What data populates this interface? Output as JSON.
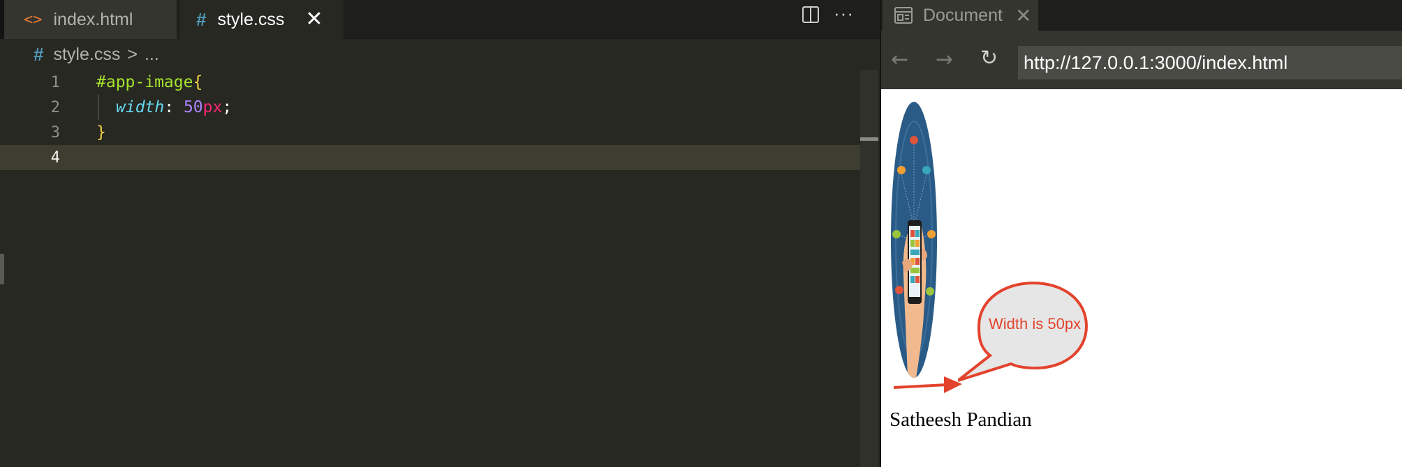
{
  "editor": {
    "tabs": [
      {
        "label": "index.html",
        "icon": "code-icon",
        "active": false
      },
      {
        "label": "style.css",
        "icon": "hash-icon",
        "active": true
      }
    ],
    "tab_close_glyph": "✕",
    "breadcrumb": {
      "file": "style.css",
      "separator": ">",
      "more": "..."
    },
    "code_lines": [
      {
        "number": "1",
        "selector": "#app-image",
        "open_brace": "{"
      },
      {
        "number": "2",
        "property": "width",
        "colon": ": ",
        "number_value": "50",
        "unit": "px",
        "semicolon": ";"
      },
      {
        "number": "3",
        "close_brace": "}"
      },
      {
        "number": "4"
      }
    ],
    "more_actions_glyph": "···"
  },
  "browser": {
    "tab_label": "Document",
    "tab_close_glyph": "✕",
    "nav": {
      "back": "←",
      "forward": "→",
      "reload": "↻"
    },
    "url": "http://127.0.0.1:3000/index.html",
    "page": {
      "callout_text": "Width is 50px",
      "name_text": "Satheesh Pandian"
    }
  },
  "colors": {
    "editor_bg": "#272822",
    "callout_red": "#e3432d",
    "selector_green": "#a6e22e",
    "brace_yellow": "#f5d142",
    "property_cyan": "#66d9ef",
    "number_purple": "#ae81ff",
    "unit_pink": "#f92672"
  }
}
